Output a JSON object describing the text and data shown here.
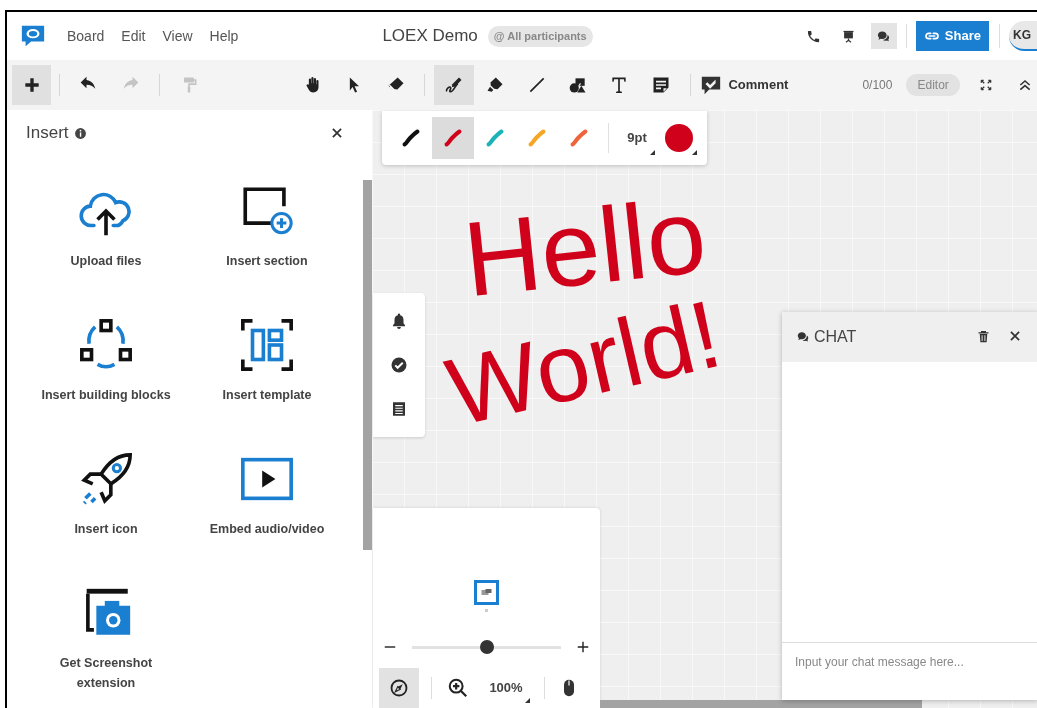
{
  "menu": [
    {
      "label": "Board"
    },
    {
      "label": "Edit"
    },
    {
      "label": "View"
    },
    {
      "label": "Help"
    }
  ],
  "board_title": "LOEX Demo",
  "mention_chip": "@ All participants",
  "header_actions": [
    {
      "kind": "phone",
      "selected": false
    },
    {
      "kind": "presentation",
      "selected": false
    },
    {
      "kind": "chat",
      "selected": true
    }
  ],
  "share_button": "Share",
  "avatar": "KG",
  "toolbar": {
    "groups": [
      {
        "tools": [
          {
            "kind": "add",
            "selected": true,
            "disabled": false
          }
        ]
      },
      {
        "tools": [
          {
            "kind": "undo",
            "selected": false,
            "disabled": false
          },
          {
            "kind": "redo",
            "selected": false,
            "disabled": true
          }
        ]
      },
      {
        "tools": [
          {
            "kind": "painter",
            "selected": false,
            "disabled": true
          }
        ]
      },
      {
        "tools": [
          {
            "kind": "hand",
            "selected": false,
            "disabled": false
          },
          {
            "kind": "pointer",
            "selected": false,
            "disabled": false
          },
          {
            "kind": "eraser",
            "selected": false,
            "disabled": false
          }
        ]
      },
      {
        "tools": [
          {
            "kind": "pen",
            "selected": true,
            "disabled": false
          },
          {
            "kind": "highlighter",
            "selected": false,
            "disabled": false
          },
          {
            "kind": "line",
            "selected": false,
            "disabled": false
          },
          {
            "kind": "shapes",
            "selected": false,
            "disabled": false
          },
          {
            "kind": "text",
            "selected": false,
            "disabled": false
          },
          {
            "kind": "note",
            "selected": false,
            "disabled": false
          }
        ]
      }
    ],
    "comment_button": "Comment",
    "counter": "0/100",
    "role_chip": "Editor"
  },
  "pen_palette": {
    "pens": [
      {
        "color": "#111111",
        "selected": false
      },
      {
        "color": "#d0021b",
        "selected": true
      },
      {
        "color": "#1ab3b8",
        "selected": false
      },
      {
        "color": "#f5a623",
        "selected": false
      },
      {
        "color": "#f0643c",
        "selected": false
      }
    ],
    "size": "9pt",
    "current": {
      "color": "#d0021b"
    }
  },
  "insert_panel": {
    "title": "Insert",
    "items": [
      {
        "kind": "upload",
        "label": "Upload files"
      },
      {
        "kind": "section",
        "label": "Insert section"
      },
      {
        "kind": "blocks",
        "label": "Insert building blocks"
      },
      {
        "kind": "template",
        "label": "Insert template"
      },
      {
        "kind": "rocket",
        "label": "Insert icon"
      },
      {
        "kind": "video",
        "label": "Embed audio/video"
      },
      {
        "kind": "screenshot",
        "label": "Get Screenshot extension"
      }
    ]
  },
  "side_tools": [
    {
      "kind": "bell"
    },
    {
      "kind": "check"
    },
    {
      "kind": "list"
    }
  ],
  "ink": {
    "color": "#d0021b",
    "lines": [
      {
        "text": "Hello"
      },
      {
        "text": "World!"
      }
    ]
  },
  "navigator": {
    "zoom": {
      "level": 0.5
    },
    "zoom_reading": "100%",
    "compass_selected": true
  },
  "chat": {
    "title": "CHAT",
    "placeholder": "Input your chat message here..."
  }
}
